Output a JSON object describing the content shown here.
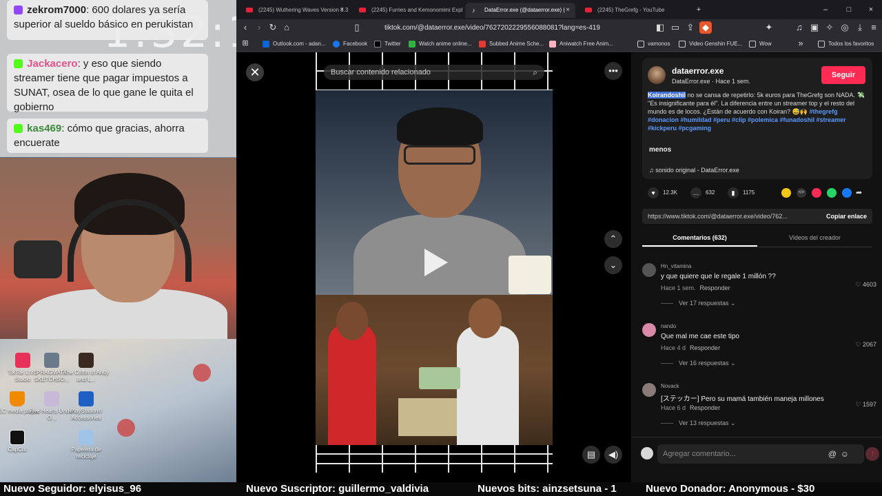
{
  "stream": {
    "clock": "1:32:18",
    "chat": [
      {
        "user": "zekrom7000",
        "text": ": 600 dolares ya sería superior al sueldo básico en perukistan"
      },
      {
        "user": "Jackacero",
        "text": ": y eso que siendo streamer tiene que pagar impuestos a SUNAT, osea de lo que gane le quita el gobierno"
      },
      {
        "user": "kas469",
        "text": ": cómo que gracias, ahorra encuerate"
      }
    ],
    "desktop_icons": [
      {
        "label": "TikTok LIVE Studio"
      },
      {
        "label": "PRAGMATA SKETCHBO..."
      },
      {
        "label": "The Coffin of Andy and L..."
      },
      {
        "label": "VLC media player"
      },
      {
        "label": "Five Hearts Under O..."
      },
      {
        "label": "PlayStation® Accessories"
      },
      {
        "label": "CapCut"
      },
      {
        "label": "Papelera de reciclaje"
      }
    ]
  },
  "browser": {
    "tabs": [
      {
        "label": "(2245) Wuthering Waves Version 3.3"
      },
      {
        "label": "(2245) Furries and Kemonomimi Expl"
      },
      {
        "label": "DataError.exe (@dataerror.exe) |"
      },
      {
        "label": "(2245) TheGrefg - YouTube"
      }
    ],
    "url": "tiktok.com/@dataerror.exe/video/7627202229556088081?lang=es-419",
    "bookmarks": [
      {
        "label": "Outlook.com - adan..."
      },
      {
        "label": "Facebook"
      },
      {
        "label": "Twitter"
      },
      {
        "label": "Watch anime online..."
      },
      {
        "label": "Subbed Anime Sche..."
      },
      {
        "label": "Aniwatch Free Anim..."
      },
      {
        "label": "vamonos"
      },
      {
        "label": "Video Genshin FUE..."
      },
      {
        "label": "Wow"
      },
      {
        "label": "Todos los favoritos"
      }
    ]
  },
  "player": {
    "search_placeholder": "Buscar contenido relacionado"
  },
  "creator": {
    "handle": "dataerror.exe",
    "byline": "DataError.exe · Hace 1 sem.",
    "follow_label": "Seguir",
    "mention": "Koirandoshii",
    "description": " no se cansa de repetirlo: 5k euros para TheGrefg son NADA. 💸 \"Es insignificante para él\". La diferencia entre un streamer top y el resto del mundo es de locos. ¿Están de acuerdo con Koiran? 😅🙌",
    "hashtags": "#thegrefg #donacion #humildad #peru #clip #polemica #funadoshil #streamer #kickperu #pcgaming",
    "less_label": "menos",
    "sound": "sonido original - DataError.exe"
  },
  "stats": {
    "likes": "12.3K",
    "comments": "632",
    "saves": "1175"
  },
  "link": {
    "url": "https://www.tiktok.com/@dataerror.exe/video/762...",
    "copy_label": "Copiar enlace"
  },
  "panel_tabs": [
    {
      "label": "Comentarios (632)"
    },
    {
      "label": "Videos del creador"
    }
  ],
  "comments": [
    {
      "user": "Hn_vitamina",
      "text": "y que quiere que le regale 1 millón ??",
      "time": "Hace 1 sem.",
      "reply": "Responder",
      "likes": "4603",
      "more": "Ver 17 respuestas ⌄"
    },
    {
      "user": "nando",
      "text": "Que mal me cae este tipo",
      "time": "Hace 4 d",
      "reply": "Responder",
      "likes": "2067",
      "more": "Ver 16 respuestas ⌄"
    },
    {
      "user": "Novack",
      "text": "[ステッカー] Pero su mamá también maneja millones",
      "time": "Hace 6 d",
      "reply": "Responder",
      "likes": "1597",
      "more": "Ver 13 respuestas ⌄"
    }
  ],
  "comment_input": {
    "placeholder": "Agregar comentario..."
  },
  "ticker": [
    {
      "text": "Nuevo Seguidor: elyisus_96"
    },
    {
      "text": "Nuevo Suscriptor: guillermo_valdivia"
    },
    {
      "text": "Nuevos bits: ainzsetsuna - 1"
    },
    {
      "text": "Nuevo Donador: Anonymous - $30"
    }
  ],
  "colors": {
    "accent": "#fe2c55",
    "hashtag": "#5b9aff",
    "mention_bg": "#3f6fd8"
  }
}
